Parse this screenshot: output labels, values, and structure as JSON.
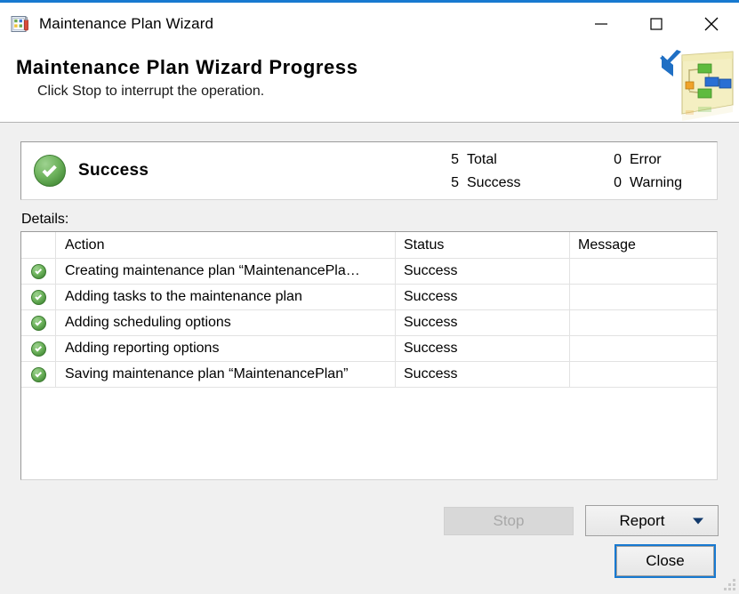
{
  "window": {
    "title": "Maintenance Plan Wizard",
    "app_icon": "maintenance-plan-icon",
    "accent_color": "#1779d0",
    "controls": {
      "minimize": "minimize-icon",
      "maximize": "maximize-icon",
      "close": "close-icon"
    }
  },
  "banner": {
    "title": "Maintenance Plan Wizard Progress",
    "subtitle": "Click Stop to interrupt the operation.",
    "art": "maintenance-plan-diagram-icon",
    "check": "checkmark-icon"
  },
  "summary": {
    "status_icon": "success-check-icon",
    "status_text": "Success",
    "counts": [
      {
        "value": "5",
        "label": "Total"
      },
      {
        "value": "5",
        "label": "Success"
      },
      {
        "value": "0",
        "label": "Error"
      },
      {
        "value": "0",
        "label": "Warning"
      }
    ]
  },
  "details": {
    "label": "Details:",
    "columns": [
      "",
      "Action",
      "Status",
      "Message"
    ],
    "rows": [
      {
        "icon": "success-check-icon",
        "action": "Creating maintenance plan “MaintenancePla…",
        "status": "Success",
        "message": ""
      },
      {
        "icon": "success-check-icon",
        "action": "Adding tasks to the maintenance plan",
        "status": "Success",
        "message": ""
      },
      {
        "icon": "success-check-icon",
        "action": "Adding scheduling options",
        "status": "Success",
        "message": ""
      },
      {
        "icon": "success-check-icon",
        "action": "Adding reporting options",
        "status": "Success",
        "message": ""
      },
      {
        "icon": "success-check-icon",
        "action": "Saving maintenance plan “MaintenancePlan”",
        "status": "Success",
        "message": ""
      }
    ]
  },
  "buttons": {
    "stop": "Stop",
    "stop_enabled": false,
    "report": "Report",
    "report_caret": "chevron-down-icon",
    "close": "Close"
  }
}
